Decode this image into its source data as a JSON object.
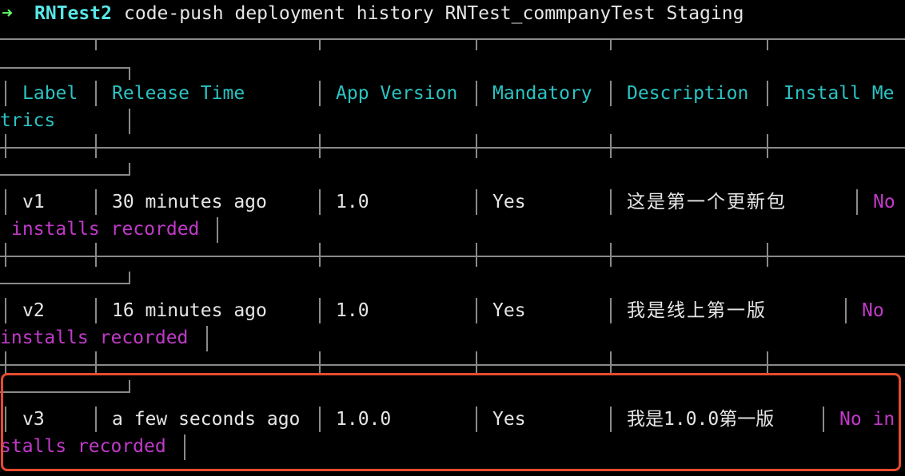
{
  "command": {
    "arrow": "➜",
    "directory": "RNTest2",
    "text": "code-push deployment history RNTest_commpanyTest Staging"
  },
  "table": {
    "headers": {
      "label": "Label",
      "release_time": "Release Time",
      "app_version": "App Version",
      "mandatory": "Mandatory",
      "description": "Description",
      "install_metrics_part1": "Install Me",
      "install_metrics_part2": "trics"
    },
    "rows": [
      {
        "label": "v1",
        "release_time": "30 minutes ago",
        "app_version": "1.0",
        "mandatory": "Yes",
        "description": "这是第一个更新包",
        "metrics_part1": "No",
        "metrics_part2": "installs recorded"
      },
      {
        "label": "v2",
        "release_time": "16 minutes ago",
        "app_version": "1.0",
        "mandatory": "Yes",
        "description": "我是线上第一版",
        "metrics_part1": "No",
        "metrics_part2": "installs recorded"
      },
      {
        "label": "v3",
        "release_time": "a few seconds ago",
        "app_version": "1.0.0",
        "mandatory": "Yes",
        "description": "我是1.0.0第一版",
        "metrics_part1": "No in",
        "metrics_part2": "stalls recorded"
      }
    ]
  },
  "colors": {
    "prompt_arrow": "#5ff967",
    "prompt_directory": "#58e6e6",
    "header_text": "#2bc3c3",
    "cell_text": "#e6e6e6",
    "metrics_text": "#c13ac9",
    "border": "#8a8a8a",
    "highlight": "#e64b2f",
    "background": "#000000"
  }
}
